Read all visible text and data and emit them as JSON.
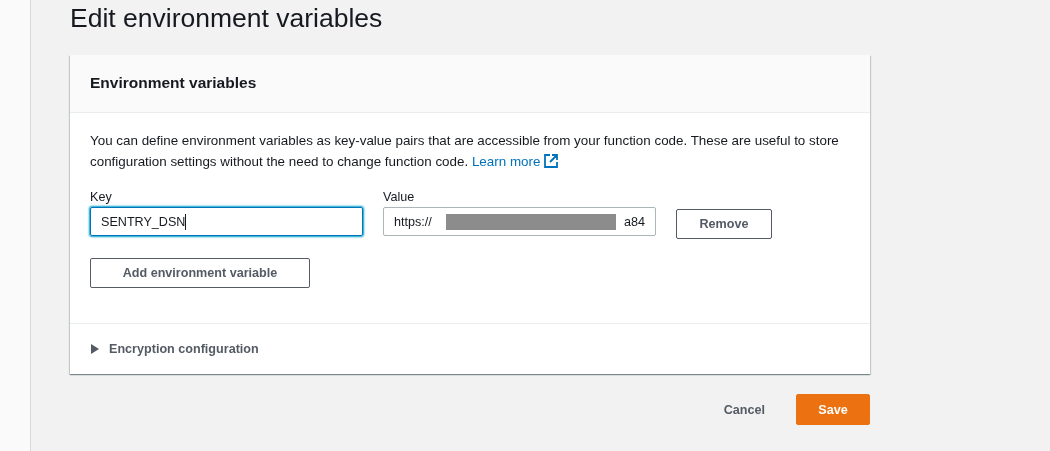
{
  "page": {
    "title": "Edit environment variables"
  },
  "panel": {
    "title": "Environment variables",
    "description": "You can define environment variables as key-value pairs that are accessible from your function code. These are useful to store configuration settings without the need to change function code.",
    "learn_more": "Learn more"
  },
  "variables": [
    {
      "key_label": "Key",
      "key": "SENTRY_DSN",
      "key_focused": true,
      "value_label": "Value",
      "value_start": "https://",
      "value_end": "a84",
      "redacted": true,
      "remove": "Remove"
    }
  ],
  "add_button": "Add environment variable",
  "encryption": {
    "label": "Encryption configuration",
    "expanded": false
  },
  "actions": {
    "cancel": "Cancel",
    "save": "Save"
  }
}
